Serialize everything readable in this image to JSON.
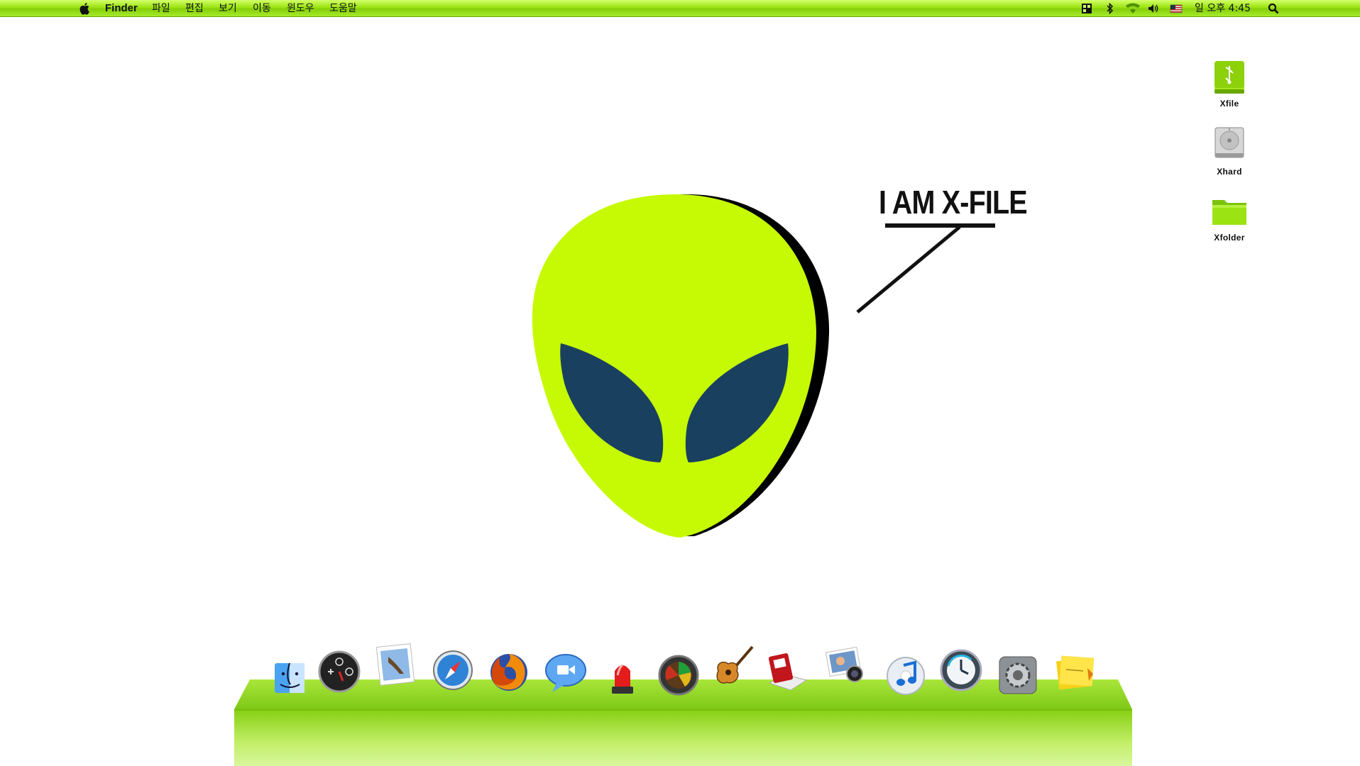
{
  "menubar": {
    "app_name": "Finder",
    "menus": [
      "파일",
      "편집",
      "보기",
      "이동",
      "윈도우",
      "도움말"
    ],
    "clock": "일 오후 4:45",
    "status_icons": [
      "spaces-icon",
      "bluetooth-icon",
      "wifi-icon",
      "volume-icon",
      "input-flag-icon",
      "spotlight-icon"
    ]
  },
  "desktop_icons": [
    {
      "name": "xfile-usb-drive-icon",
      "label": "Xfile"
    },
    {
      "name": "xhard-hard-drive-icon",
      "label": "Xhard"
    },
    {
      "name": "xfolder-folder-icon",
      "label": "Xfolder"
    }
  ],
  "wallpaper": {
    "callout": "I AM X-FILE",
    "alien_color": "#c6fa04",
    "eye_color": "#1a4060"
  },
  "dock": {
    "items": [
      "finder-icon",
      "dashboard-icon",
      "mail-icon",
      "safari-icon",
      "firefox-icon",
      "ichat-icon",
      "siren-alert-icon",
      "radar-app-icon",
      "garageband-icon",
      "photo-booth-book-icon",
      "iphoto-icon",
      "itunes-icon",
      "time-machine-icon",
      "system-preferences-icon",
      "stickies-icon"
    ]
  },
  "colors": {
    "menubar_green": "#9be312",
    "dock_green": "#8fd81a",
    "alien_green": "#c6fa04"
  }
}
